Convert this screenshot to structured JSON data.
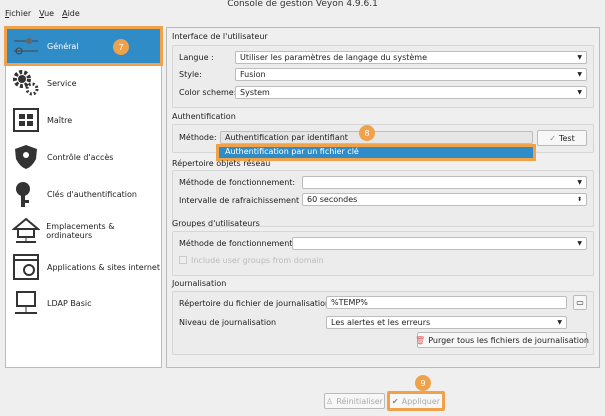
{
  "window": {
    "title": "Console de gestion Veyon 4.9.6.1"
  },
  "menu": [
    "Fichier",
    "Vue",
    "Aide"
  ],
  "sidebar": {
    "items": [
      {
        "label": "Général",
        "icon": "sliders-icon"
      },
      {
        "label": "Service",
        "icon": "gears-icon"
      },
      {
        "label": "Maître",
        "icon": "grid-icon"
      },
      {
        "label": "Contrôle d'accès",
        "icon": "shield-icon"
      },
      {
        "label": "Clés d'authentification",
        "icon": "key-icon"
      },
      {
        "label": "Emplacements & ordinateurs",
        "icon": "network-icon"
      },
      {
        "label": "Applications & sites internet",
        "icon": "apps-icon"
      },
      {
        "label": "LDAP Basic",
        "icon": "ldap-icon"
      }
    ]
  },
  "badges": {
    "b7": "7",
    "b8": "8",
    "b9": "9"
  },
  "ui": {
    "title": "Interface de l'utilisateur",
    "langue_label": "Langue :",
    "langue": "Utiliser les paramètres de langage du système",
    "style_label": "Style:",
    "style": "Fusion",
    "scheme_label": "Color scheme:",
    "scheme": "System"
  },
  "auth": {
    "title": "Authentification",
    "method_label": "Méthode:",
    "method": "Authentification par identifiant",
    "option": "Authentification par un fichier clé",
    "test": "Test"
  },
  "dir": {
    "title": "Répertoire objets réseau",
    "method_label": "Méthode de fonctionnement:",
    "method": "",
    "interval_label": "Intervalle de rafraichissement :",
    "interval": "60 secondes"
  },
  "groups": {
    "title": "Groupes d'utilisateurs",
    "method_label": "Méthode de fonctionnement:",
    "method": "",
    "include": "Include user groups from domain",
    "include_checked": false
  },
  "log": {
    "title": "Journalisation",
    "dir_label": "Répertoire du fichier de journalisation",
    "dir": "%TEMP%",
    "level_label": "Niveau de journalisation",
    "level": "Les alertes et les erreurs",
    "purge": "Purger tous les fichiers de journalisation"
  },
  "footer": {
    "reset": "Réinitialiser",
    "apply": "Appliquer"
  },
  "colors": {
    "accent": "#308cc6",
    "highlight": "#f0a24a"
  }
}
